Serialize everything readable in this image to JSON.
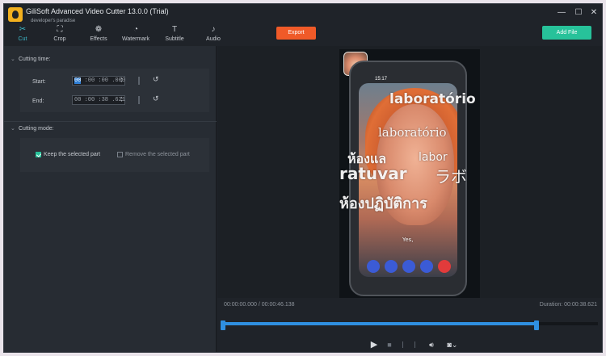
{
  "window": {
    "title": "GiliSoft Advanced Video Cutter 13.0.0 (Trial)",
    "watermark": "developer's paradise"
  },
  "toolbar": {
    "tools": [
      {
        "label": "Cut",
        "icon": "scissors-icon",
        "glyph": "✂",
        "active": true
      },
      {
        "label": "Crop",
        "icon": "crop-icon",
        "glyph": "⛶",
        "active": false
      },
      {
        "label": "Effects",
        "icon": "effects-icon",
        "glyph": "❁",
        "active": false
      },
      {
        "label": "Watermark",
        "icon": "watermark-icon",
        "glyph": "◔",
        "active": false
      },
      {
        "label": "Subtitle",
        "icon": "subtitle-icon",
        "glyph": "T",
        "active": false
      },
      {
        "label": "Audio",
        "icon": "audio-icon",
        "glyph": "♪",
        "active": false
      }
    ],
    "export_label": "Export",
    "add_file_label": "Add File"
  },
  "cutting_time": {
    "heading": "Cutting time:",
    "start_label": "Start:",
    "start_hours": "00",
    "start_rest": " :00 :00 .000",
    "end_label": "End:",
    "end_value": "00 :00 :38 .621"
  },
  "cutting_mode": {
    "heading": "Cutting mode:",
    "keep_label": "Keep the selected part",
    "keep_checked": true,
    "remove_label": "Remove the selected part",
    "remove_checked": false
  },
  "video_overlay": {
    "status_time": "15:17",
    "text1": "laboratório",
    "text2": "laboratório",
    "text3": "ห้องแล",
    "text4": "labor",
    "text5": "ratuvar",
    "text6": "ラボ",
    "text7": "ห้องปฏิบัติการ",
    "text8": "Yes,"
  },
  "timeline": {
    "position_text": "00:00:00.000 / 00:00:46.138",
    "duration_text": "Duration: 00:00:38.621",
    "selection_start_fraction": 0.0,
    "selection_end_fraction": 0.837
  },
  "colors": {
    "accent": "#3db8c8",
    "export": "#f05a28",
    "add_file": "#27c29a",
    "timeline": "#2f8fe0"
  }
}
